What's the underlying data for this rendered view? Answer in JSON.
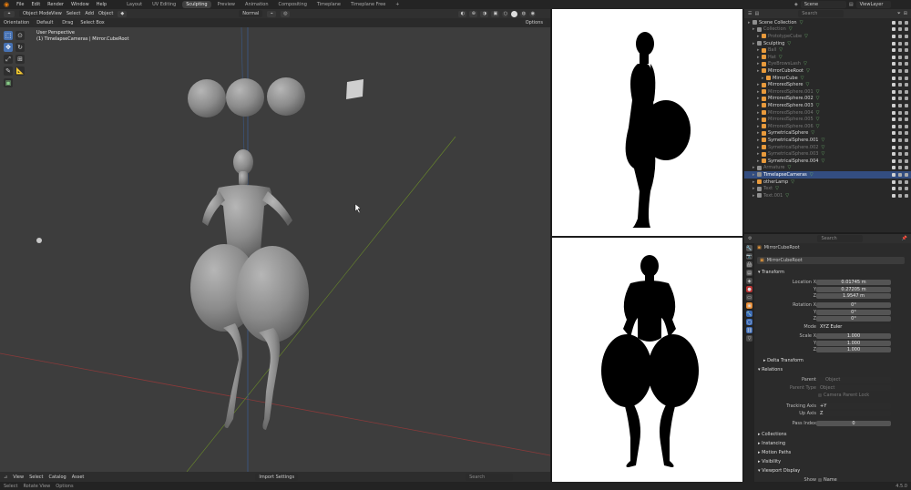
{
  "menus": [
    "File",
    "Edit",
    "Render",
    "Window",
    "Help"
  ],
  "workspaces": [
    "Layout",
    "UV Editing",
    "Sculpting",
    "Preview",
    "Animation",
    "Compositing",
    "Timeplane",
    "Timeplane Free"
  ],
  "workspace_add": "+",
  "scene": {
    "label": "Scene",
    "layer": "ViewLayer"
  },
  "viewport": {
    "mode": "Object Mode",
    "view_menus": [
      "View",
      "Select",
      "Add",
      "Object"
    ],
    "transform": "Normal",
    "orientation_label": "Orientation",
    "orientation": "Default",
    "drag_label": "Drag",
    "drag": "Select Box",
    "options": "Options",
    "info_title": "User Perspective",
    "info_sub": "(1) TimelapseCameras | Mirror.CubeRoot"
  },
  "bottom": {
    "menus": [
      "View",
      "Select",
      "Catalog",
      "Asset"
    ],
    "import": "Import Settings",
    "search_placeholder": "Search"
  },
  "statusbar": {
    "select": "Select",
    "rotate": "Rotate View",
    "options": "Options",
    "version": "4.5.0"
  },
  "outliner": {
    "search_placeholder": "Search",
    "rows": [
      {
        "name": "Scene Collection",
        "indent": 0,
        "icon": "#8f8f8f",
        "dim": false,
        "sel": false
      },
      {
        "name": "Collection",
        "indent": 1,
        "icon": "#8f8f8f",
        "dim": true,
        "sel": false
      },
      {
        "name": "PrototypeCube",
        "indent": 2,
        "icon": "#e89a3c",
        "dim": true,
        "sel": false
      },
      {
        "name": "Sculpting",
        "indent": 1,
        "icon": "#8f8f8f",
        "dim": false,
        "sel": false
      },
      {
        "name": "Ball",
        "indent": 2,
        "icon": "#e89a3c",
        "dim": true,
        "sel": false
      },
      {
        "name": "Hat",
        "indent": 2,
        "icon": "#e89a3c",
        "dim": true,
        "sel": false
      },
      {
        "name": "EyeBrowsLash",
        "indent": 2,
        "icon": "#e89a3c",
        "dim": true,
        "sel": false
      },
      {
        "name": "MirrorCubeRoot",
        "indent": 2,
        "icon": "#e89a3c",
        "dim": false,
        "sel": false
      },
      {
        "name": "MirrorCube",
        "indent": 3,
        "icon": "#e89a3c",
        "dim": false,
        "sel": false
      },
      {
        "name": "MirroredSphere",
        "indent": 2,
        "icon": "#e89a3c",
        "dim": false,
        "sel": false
      },
      {
        "name": "MirroredSphere.001",
        "indent": 2,
        "icon": "#e89a3c",
        "dim": true,
        "sel": false
      },
      {
        "name": "MirroredSphere.002",
        "indent": 2,
        "icon": "#e89a3c",
        "dim": false,
        "sel": false
      },
      {
        "name": "MirroredSphere.003",
        "indent": 2,
        "icon": "#e89a3c",
        "dim": false,
        "sel": false
      },
      {
        "name": "MirroredSphere.004",
        "indent": 2,
        "icon": "#e89a3c",
        "dim": true,
        "sel": false
      },
      {
        "name": "MirroredSphere.005",
        "indent": 2,
        "icon": "#e89a3c",
        "dim": true,
        "sel": false
      },
      {
        "name": "MirroredSphere.006",
        "indent": 2,
        "icon": "#e89a3c",
        "dim": true,
        "sel": false
      },
      {
        "name": "SymetricalSphere",
        "indent": 2,
        "icon": "#e89a3c",
        "dim": false,
        "sel": false
      },
      {
        "name": "SymetricalSphere.001",
        "indent": 2,
        "icon": "#e89a3c",
        "dim": false,
        "sel": false
      },
      {
        "name": "SymetricalSphere.002",
        "indent": 2,
        "icon": "#e89a3c",
        "dim": true,
        "sel": false
      },
      {
        "name": "SymetricalSphere.003",
        "indent": 2,
        "icon": "#e89a3c",
        "dim": true,
        "sel": false
      },
      {
        "name": "SymetricalSphere.004",
        "indent": 2,
        "icon": "#e89a3c",
        "dim": false,
        "sel": false
      },
      {
        "name": "Armature",
        "indent": 1,
        "icon": "#8f8f8f",
        "dim": true,
        "sel": false
      },
      {
        "name": "TimelapseCameras",
        "indent": 1,
        "icon": "#8f8f8f",
        "dim": false,
        "sel": true
      },
      {
        "name": "otherLamp",
        "indent": 1,
        "icon": "#e89a3c",
        "dim": false,
        "sel": false
      },
      {
        "name": "Text",
        "indent": 1,
        "icon": "#8f8f8f",
        "dim": true,
        "sel": false
      },
      {
        "name": "Text.001",
        "indent": 1,
        "icon": "#8f8f8f",
        "dim": true,
        "sel": false
      }
    ]
  },
  "properties": {
    "search_placeholder": "Search",
    "object_header": "MirrorCubeRoot",
    "object_name": "MirrorCubeRoot",
    "transform_label": "Transform",
    "location_label": "Location X",
    "rotation_label": "Rotation X",
    "scale_label": "Scale X",
    "y": "Y",
    "z": "Z",
    "location": [
      "0.01745 m",
      "0.27205 m",
      "1.9547 m"
    ],
    "rotation": [
      "0°",
      "0°",
      "0°"
    ],
    "mode_label": "Mode",
    "mode": "XYZ Euler",
    "scale": [
      "1.000",
      "1.000",
      "1.000"
    ],
    "delta": "Delta Transform",
    "relations": "Relations",
    "parent_label": "Parent",
    "parent_placeholder": "Object",
    "parent_type_label": "Parent Type",
    "parent_type": "Object",
    "camera_parent_lock": "Camera Parent Lock",
    "tracking_label": "Tracking Axis",
    "tracking": "+Y",
    "up_label": "Up Axis",
    "up": "Z",
    "pass_label": "Pass Index",
    "pass": "0",
    "sections": [
      "Collections",
      "Instancing",
      "Motion Paths",
      "Visibility",
      "Viewport Display"
    ],
    "show_label": "Show",
    "show_val": "Name"
  }
}
